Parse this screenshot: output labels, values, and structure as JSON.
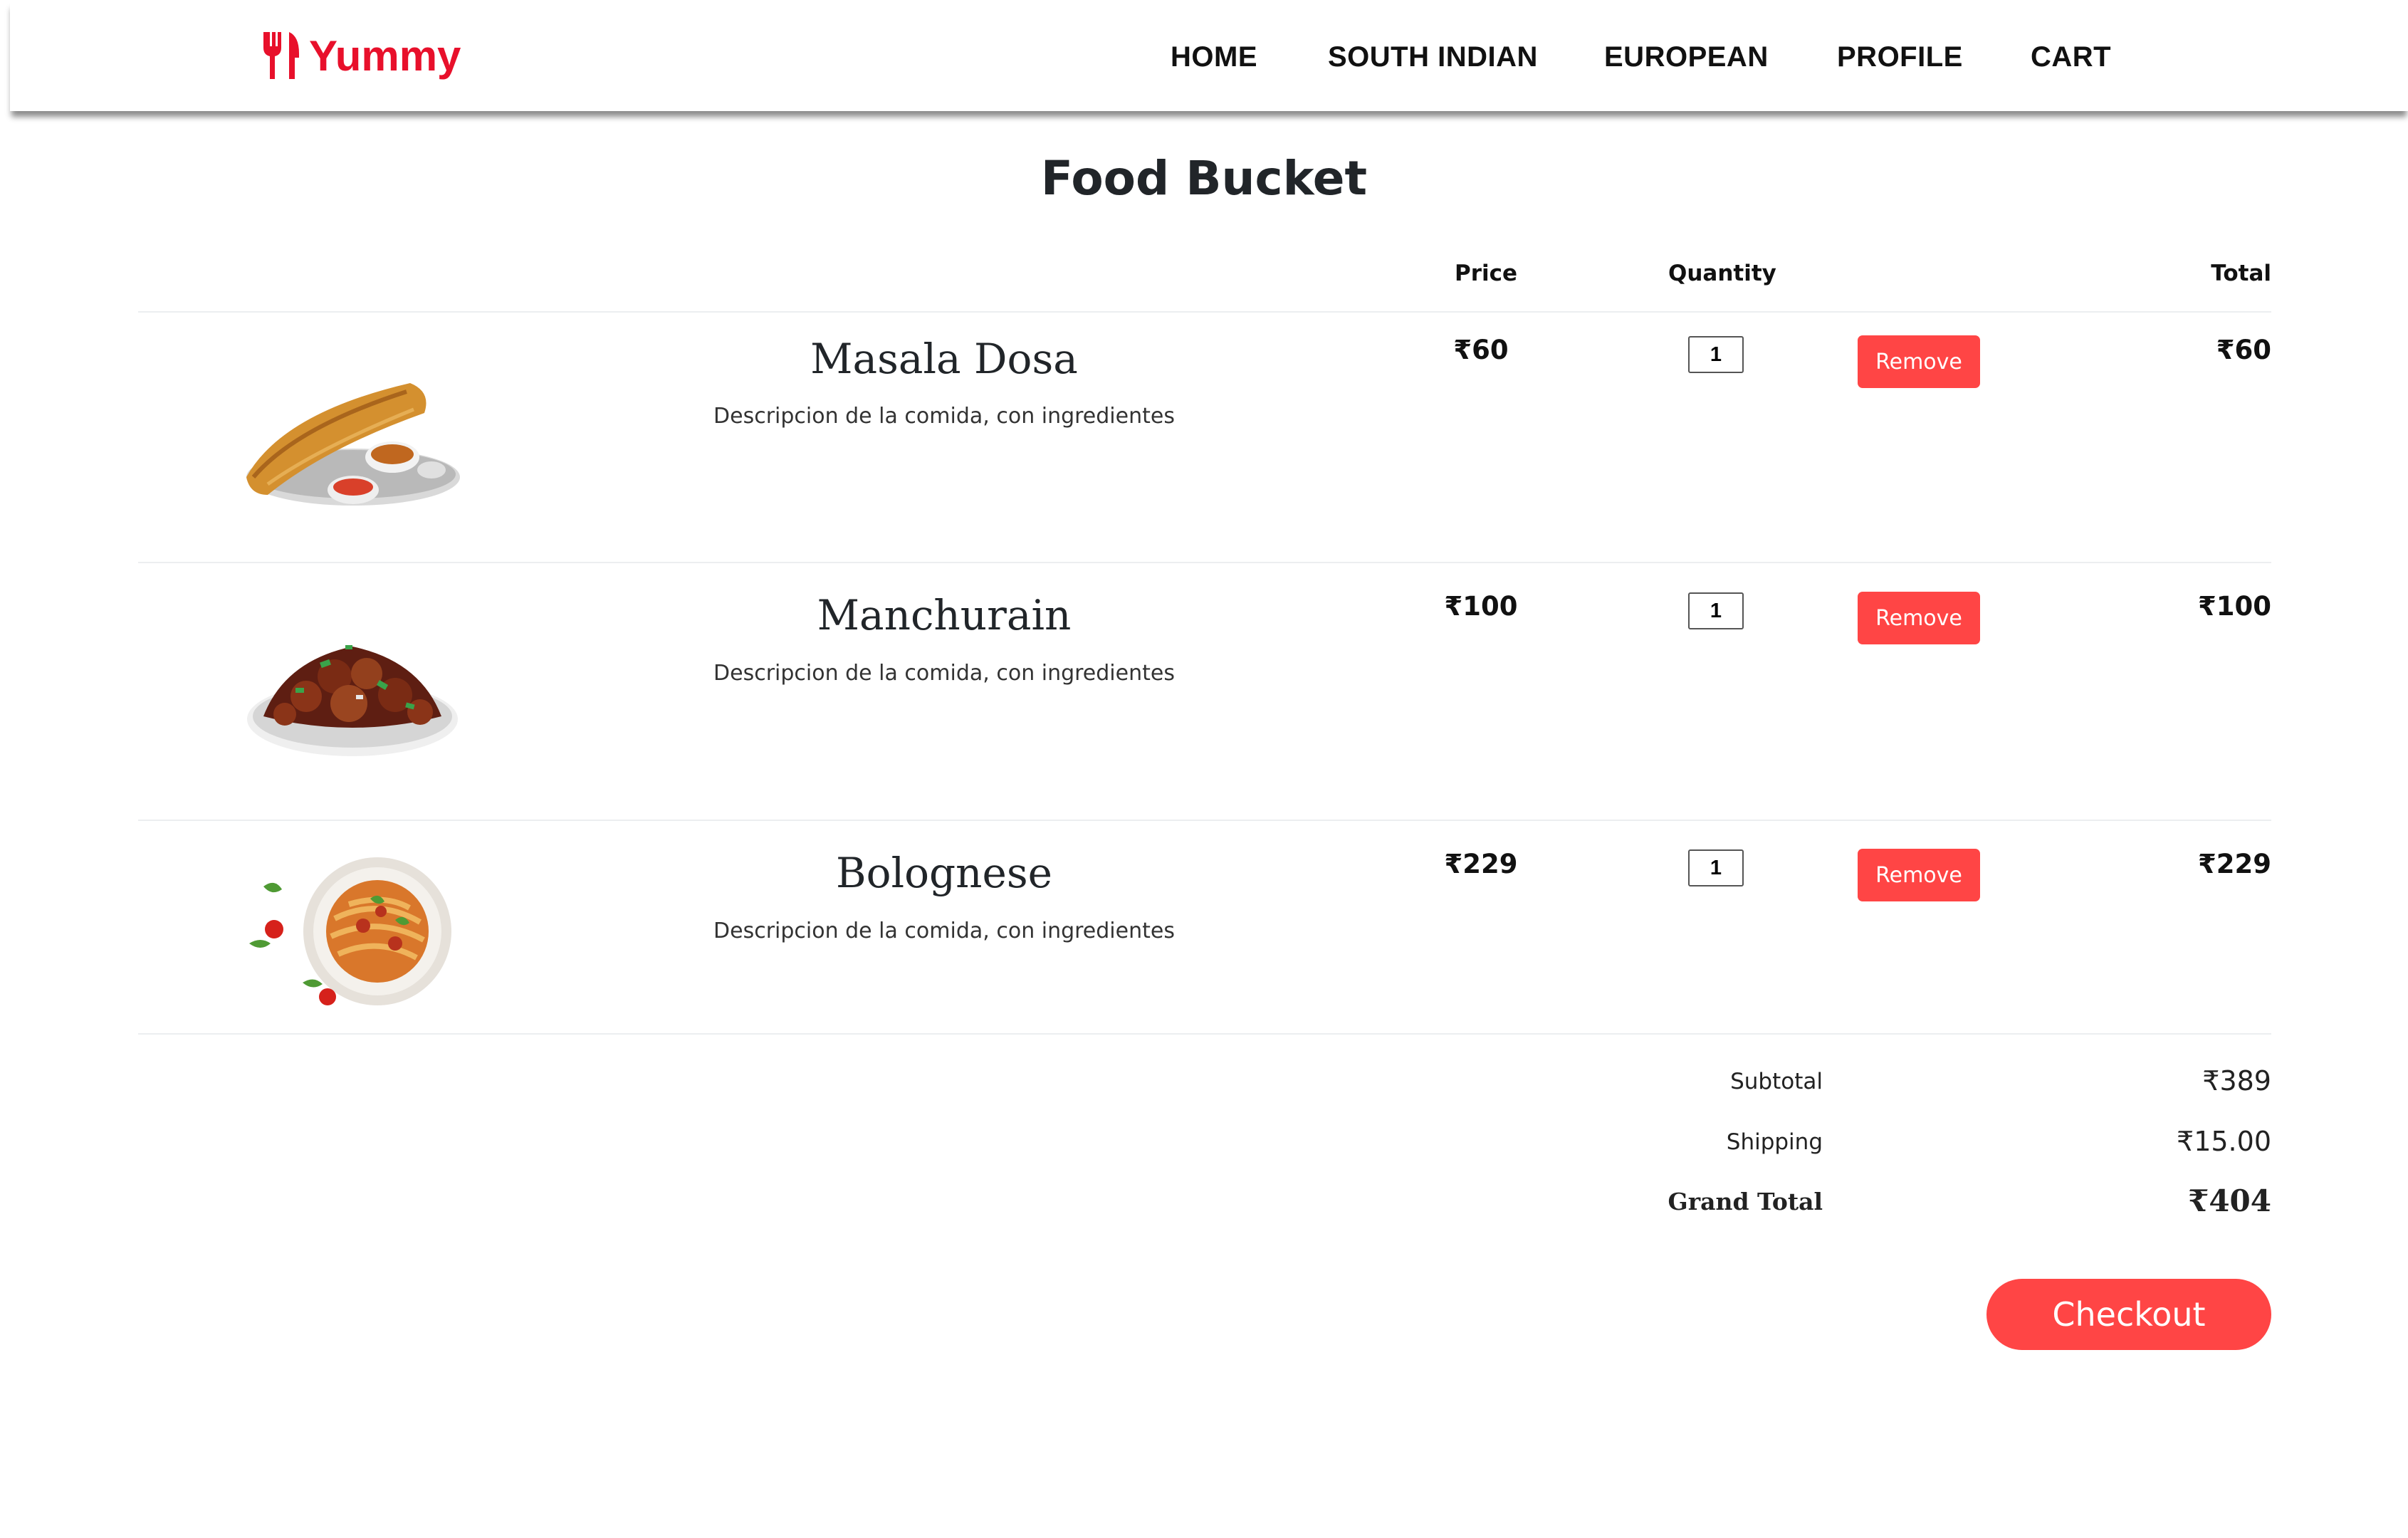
{
  "brand": {
    "name": "Yummy",
    "color": "#e8102b",
    "icon": "fork-knife-icon"
  },
  "nav": {
    "home": "HOME",
    "south_indian": "SOUTH INDIAN",
    "european": "EUROPEAN",
    "profile": "PROFILE",
    "cart": "CART"
  },
  "page_title": "Food Bucket",
  "table_headers": {
    "price": "Price",
    "quantity": "Quantity",
    "total": "Total"
  },
  "items": [
    {
      "name": "Masala Dosa",
      "description": "Descripcion de la comida, con ingredientes",
      "price": "₹60",
      "quantity": "1",
      "remove_label": "Remove",
      "total": "₹60",
      "image": "masala-dosa-image"
    },
    {
      "name": "Manchurain",
      "description": "Descripcion de la comida, con ingredientes",
      "price": "₹100",
      "quantity": "1",
      "remove_label": "Remove",
      "total": "₹100",
      "image": "manchurian-image"
    },
    {
      "name": "Bolognese",
      "description": "Descripcion de la comida, con ingredientes",
      "price": "₹229",
      "quantity": "1",
      "remove_label": "Remove",
      "total": "₹229",
      "image": "bolognese-image"
    }
  ],
  "summary": {
    "subtotal_label": "Subtotal",
    "subtotal_value": "₹389",
    "shipping_label": "Shipping",
    "shipping_value": "₹15.00",
    "grand_total_label": "Grand Total",
    "grand_total_value": "₹404"
  },
  "checkout_label": "Checkout",
  "colors": {
    "accent": "#ff4545",
    "brand": "#e8102b"
  }
}
